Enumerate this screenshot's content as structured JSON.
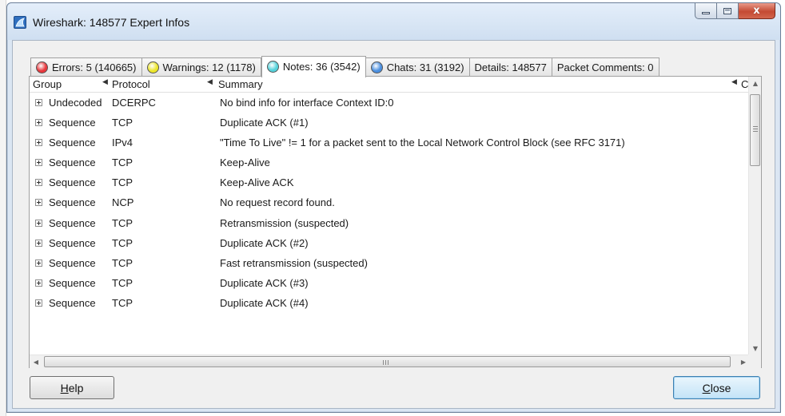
{
  "window": {
    "title": "Wireshark: 148577 Expert Infos",
    "controls": {
      "minimize": "",
      "maximize": "",
      "close": "x"
    }
  },
  "tabs": [
    {
      "label": "Errors: 5 (140665)",
      "dot_color": "#e8363b",
      "active": false
    },
    {
      "label": "Warnings: 12 (1178)",
      "dot_color": "#ece62a",
      "active": false
    },
    {
      "label": "Notes: 36 (3542)",
      "dot_color": "#55d2db",
      "active": true
    },
    {
      "label": "Chats: 31 (3192)",
      "dot_color": "#4a8fe0",
      "active": false
    },
    {
      "label": "Details: 148577",
      "dot_color": null,
      "active": false
    },
    {
      "label": "Packet Comments: 0",
      "dot_color": null,
      "active": false
    }
  ],
  "table": {
    "headers": {
      "group": "Group",
      "protocol": "Protocol",
      "summary": "Summary",
      "count": "C"
    },
    "rows": [
      {
        "group": "Undecoded",
        "protocol": "DCERPC",
        "summary": "No bind info for interface Context ID:0"
      },
      {
        "group": "Sequence",
        "protocol": "TCP",
        "summary": "Duplicate ACK (#1)"
      },
      {
        "group": "Sequence",
        "protocol": "IPv4",
        "summary": "\"Time To Live\" != 1 for a packet sent to the Local Network Control Block (see RFC 3171)"
      },
      {
        "group": "Sequence",
        "protocol": "TCP",
        "summary": "Keep-Alive"
      },
      {
        "group": "Sequence",
        "protocol": "TCP",
        "summary": "Keep-Alive ACK"
      },
      {
        "group": "Sequence",
        "protocol": "NCP",
        "summary": "No request record found."
      },
      {
        "group": "Sequence",
        "protocol": "TCP",
        "summary": "Retransmission (suspected)"
      },
      {
        "group": "Sequence",
        "protocol": "TCP",
        "summary": "Duplicate ACK (#2)"
      },
      {
        "group": "Sequence",
        "protocol": "TCP",
        "summary": "Fast retransmission (suspected)"
      },
      {
        "group": "Sequence",
        "protocol": "TCP",
        "summary": "Duplicate ACK (#3)"
      },
      {
        "group": "Sequence",
        "protocol": "TCP",
        "summary": "Duplicate ACK (#4)"
      }
    ]
  },
  "buttons": {
    "help": {
      "mnemonic": "H",
      "rest": "elp"
    },
    "close": {
      "mnemonic": "C",
      "rest": "lose"
    }
  },
  "scrollbars": {
    "horizontal_grip": "III"
  }
}
